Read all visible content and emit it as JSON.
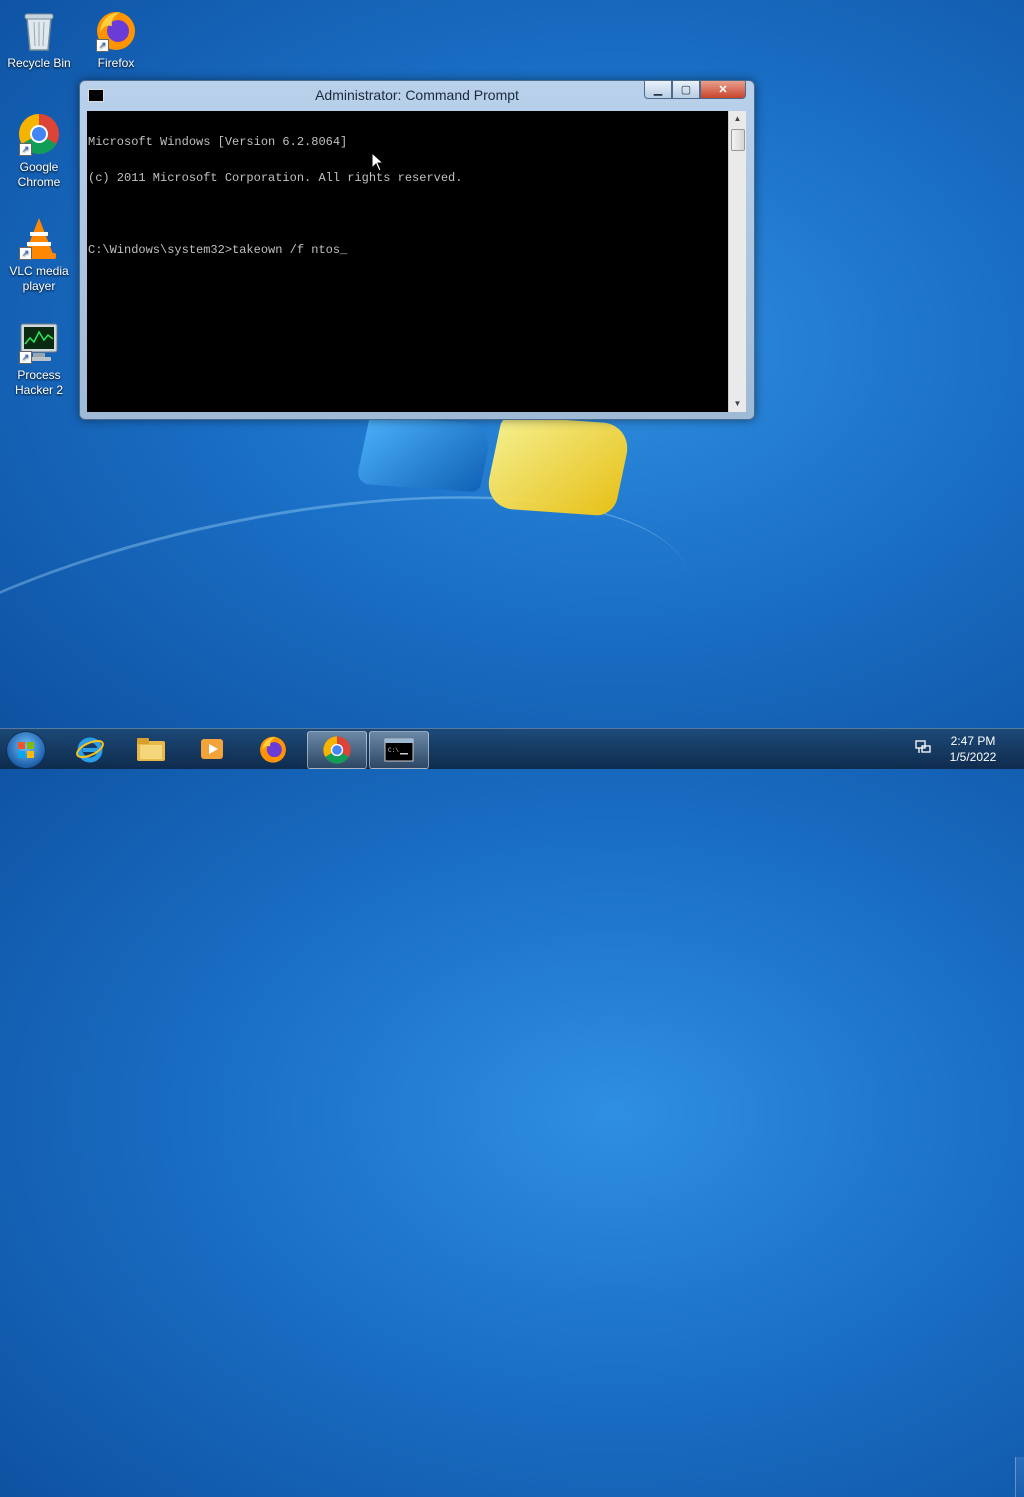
{
  "desktop": {
    "icons": [
      {
        "label": "Recycle Bin",
        "icon": "recycle-bin-icon"
      },
      {
        "label": "Firefox",
        "icon": "firefox-icon"
      },
      {
        "label": "Google Chrome",
        "icon": "chrome-icon"
      },
      {
        "label": "VLC media player",
        "icon": "vlc-icon"
      },
      {
        "label": "Process Hacker 2",
        "icon": "process-hacker-icon"
      }
    ]
  },
  "cmd": {
    "title": "Administrator: Command Prompt",
    "buttons": {
      "minimize": "minimize-icon",
      "maximize": "maximize-icon",
      "close": "close-icon"
    },
    "lines": [
      "Microsoft Windows [Version 6.2.8064]",
      "(c) 2011 Microsoft Corporation. All rights reserved.",
      "",
      "C:\\Windows\\system32>takeown /f ntos_"
    ]
  },
  "taskbar": {
    "pinned": [
      "internet-explorer-icon",
      "file-explorer-icon",
      "media-player-icon",
      "firefox-icon",
      "chrome-icon",
      "command-prompt-icon"
    ],
    "tray": {
      "network": "network-icon"
    },
    "clock": {
      "time": "2:47 PM",
      "date": "1/5/2022"
    }
  },
  "colors": {
    "console_bg": "#000000",
    "console_text": "#c0c0c0",
    "desktop_bg": "#1a6fc6",
    "close_button": "#c8442b"
  }
}
